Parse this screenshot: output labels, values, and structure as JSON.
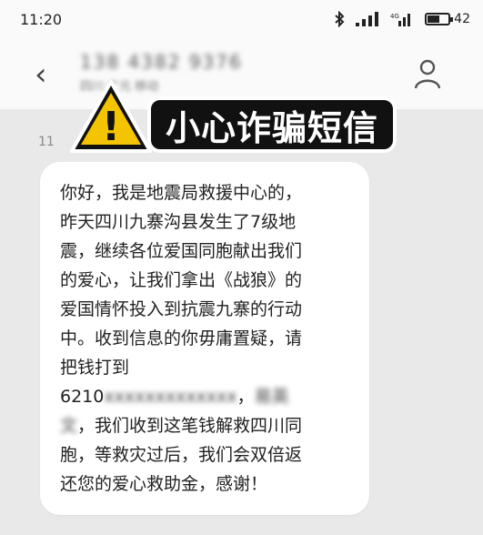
{
  "status_bar": {
    "time": "11:20",
    "battery": "42"
  },
  "header": {
    "contact_number": "138 4382 9376",
    "contact_subtitle": "四川 广元 移动"
  },
  "thread": {
    "timestamp": "11"
  },
  "warning": {
    "banner_text": "小心诈骗短信",
    "sign_glyph": "!"
  },
  "message": {
    "line1": "你好，我是地震局救援中心的，",
    "line2": "昨天四川九寨沟县发生了7级地",
    "line3": "震，继续各位爱国同胞献出我们",
    "line4": "的爱心，让我们拿出《战狼》的",
    "line5": "爱国情怀投入到抗震九寨的行动",
    "line6": "中。收到信息的你毋庸置疑，请",
    "line7": "把钱打到",
    "account_prefix": "6210",
    "account_hidden": "xxxxxxxxxxxxx",
    "account_sep": "，",
    "name_part1": "易英",
    "name_part2": "文",
    "line8_rest": "，我们收到这笔钱解救四川同",
    "line9": "胞，等救灾过后，我们会双倍返",
    "line10": "还您的爱心救助金，感谢！"
  },
  "colors": {
    "warning_yellow": "#f5c400",
    "banner_bg": "#111111",
    "page_bg": "#e9e9e9",
    "bubble_bg": "#ffffff"
  },
  "icons": {
    "back": "back-arrow-icon",
    "profile": "person-icon",
    "bluetooth": "bluetooth-icon",
    "signal": "signal-icon",
    "wifi": "wifi-icon",
    "battery": "battery-icon",
    "warning": "warning-triangle-icon"
  }
}
